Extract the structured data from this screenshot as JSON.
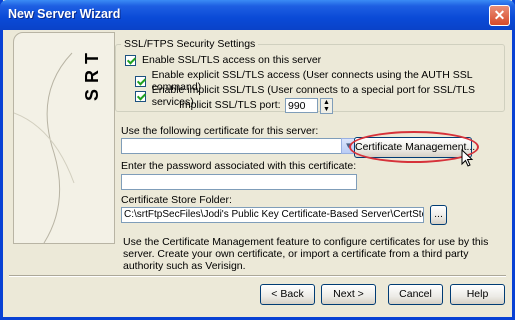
{
  "window": {
    "title": "New Server Wizard",
    "close_label": "✕"
  },
  "logo": {
    "letters": "SRT"
  },
  "ssl_group": {
    "legend": "SSL/FTPS Security Settings",
    "enable_ssl": {
      "label": "Enable SSL/TLS access on this server",
      "checked": true
    },
    "enable_explicit": {
      "label": "Enable explicit SSL/TLS access (User connects using the AUTH SSL command)",
      "checked": true
    },
    "enable_implicit": {
      "label": "Enable implicit SSL/TLS (User connects to a special port for SSL/TLS services)",
      "checked": true
    },
    "implicit_port_label": "Implicit SSL/TLS port:",
    "implicit_port_value": "990"
  },
  "certificate": {
    "use_label": "Use the following certificate for this server:",
    "selected": "",
    "management_button": "Certificate Management...",
    "password_label": "Enter the password associated with this certificate:",
    "password_value": "",
    "store_label": "Certificate Store Folder:",
    "store_value": "C:\\srtFtpSecFiles\\Jodi's Public Key Certificate-Based Server\\CertStore\\",
    "browse_button": "..."
  },
  "info_text": "Use the Certificate Management feature to configure certificates for use by this server. Create your own certificate, or import a certificate from a third party authority such as Verisign.",
  "footer": {
    "back": "< Back",
    "next": "Next >",
    "cancel": "Cancel",
    "help": "Help"
  },
  "colors": {
    "title_bar": "#0a4ad7",
    "dialog_bg": "#ece9d8",
    "highlight": "#d6323a"
  }
}
